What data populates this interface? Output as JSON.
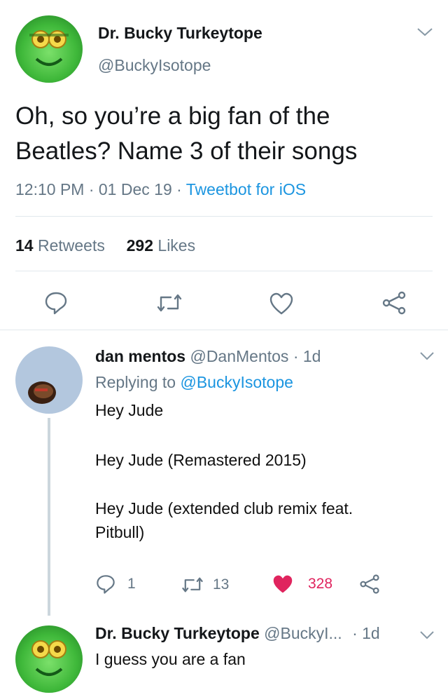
{
  "main_tweet": {
    "author_name": "Dr. Bucky Turkeytope",
    "handle": "@BuckyIsotope",
    "text_line1": "Oh, so you’re a big fan of the",
    "text_line2": "Beatles? Name 3 of their songs",
    "meta": "12:10 PM · 01 Dec 19 · ",
    "source": "Tweetbot for iOS",
    "retweets_count": "14",
    "retweets_label": "Retweets",
    "likes_count": "292",
    "likes_label": "Likes"
  },
  "reply1": {
    "author_name": "dan mentos",
    "handle_time": "@DanMentos · 1d",
    "replying_prefix": "Replying to ",
    "replying_handle": "@BuckyIsotope",
    "line1": "Hey Jude",
    "line2": "Hey Jude (Remastered 2015)",
    "line3": "Hey Jude (extended club remix feat.",
    "line4": "Pitbull)",
    "reply_count": "1",
    "retweet_count": "13",
    "like_count": "328"
  },
  "reply2": {
    "author_name": "Dr. Bucky Turkeytope",
    "handle_truncated": "@BuckyI...",
    "time": "· 1d",
    "text": "I guess you are a fan"
  },
  "colors": {
    "link": "#1b95e0",
    "muted": "#657786",
    "like_red": "#e0245e",
    "divider": "#e1e8ed",
    "avatar_green": "#3fb83a"
  },
  "icons": [
    "chevron-down-icon",
    "reply-icon",
    "retweet-icon",
    "like-icon",
    "share-icon"
  ]
}
